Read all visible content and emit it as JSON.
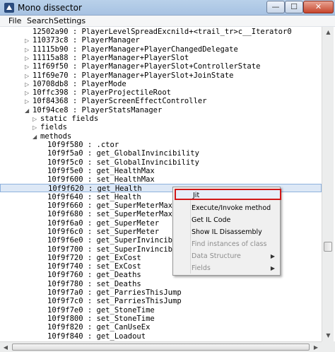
{
  "window": {
    "title": "Mono dissector",
    "minimize": "—",
    "maximize": "☐",
    "close": "✕"
  },
  "menu": {
    "file": "File",
    "search": "Search",
    "settings": "Settings"
  },
  "tree": {
    "rows": [
      {
        "text": "12502a90 : PlayerLevelSpreadExcnild+<trail_tr>c__Iterator0",
        "arrow": "",
        "indent": 0
      },
      {
        "text": "110373c8 : PlayerManager",
        "arrow": "▷",
        "indent": 0
      },
      {
        "text": "11115b90 : PlayerManager+PlayerChangedDelegate",
        "arrow": "▷",
        "indent": 0
      },
      {
        "text": "11115a88 : PlayerManager+PlayerSlot",
        "arrow": "▷",
        "indent": 0
      },
      {
        "text": "11f69f50 : PlayerManager+PlayerSlot+ControllerState",
        "arrow": "▷",
        "indent": 0
      },
      {
        "text": "11f69e70 : PlayerManager+PlayerSlot+JoinState",
        "arrow": "▷",
        "indent": 0
      },
      {
        "text": "10708db8 : PlayerMode",
        "arrow": "▷",
        "indent": 0
      },
      {
        "text": "10ffc398 : PlayerProjectileRoot",
        "arrow": "▷",
        "indent": 0
      },
      {
        "text": "10f84368 : PlayerScreenEffectController",
        "arrow": "▷",
        "indent": 0
      },
      {
        "text": "10f94ce8 : PlayerStatsManager",
        "arrow": "◢",
        "indent": 0
      },
      {
        "text": "static fields",
        "arrow": "▷",
        "indent": 1
      },
      {
        "text": "fields",
        "arrow": "▷",
        "indent": 1
      },
      {
        "text": "methods",
        "arrow": "◢",
        "indent": 1
      },
      {
        "text": "10f9f580 : .ctor",
        "arrow": "",
        "indent": 2
      },
      {
        "text": "10f9f5a0 : get_GlobalInvincibility",
        "arrow": "",
        "indent": 2
      },
      {
        "text": "10f9f5c0 : set_GlobalInvincibility",
        "arrow": "",
        "indent": 2
      },
      {
        "text": "10f9f5e0 : get_HealthMax",
        "arrow": "",
        "indent": 2
      },
      {
        "text": "10f9f600 : set_HealthMax",
        "arrow": "",
        "indent": 2
      },
      {
        "text": "10f9f620 : get_Health",
        "arrow": "",
        "indent": 2,
        "selected": true
      },
      {
        "text": "10f9f640 : set_Health",
        "arrow": "",
        "indent": 2
      },
      {
        "text": "10f9f660 : get_SuperMeterMax",
        "arrow": "",
        "indent": 2
      },
      {
        "text": "10f9f680 : set_SuperMeterMax",
        "arrow": "",
        "indent": 2
      },
      {
        "text": "10f9f6a0 : get_SuperMeter",
        "arrow": "",
        "indent": 2
      },
      {
        "text": "10f9f6c0 : set_SuperMeter",
        "arrow": "",
        "indent": 2
      },
      {
        "text": "10f9f6e0 : get_SuperInvincibl",
        "arrow": "",
        "indent": 2
      },
      {
        "text": "10f9f700 : set_SuperInvincibl",
        "arrow": "",
        "indent": 2
      },
      {
        "text": "10f9f720 : get_ExCost",
        "arrow": "",
        "indent": 2
      },
      {
        "text": "10f9f740 : set_ExCost",
        "arrow": "",
        "indent": 2
      },
      {
        "text": "10f9f760 : get_Deaths",
        "arrow": "",
        "indent": 2
      },
      {
        "text": "10f9f780 : set_Deaths",
        "arrow": "",
        "indent": 2
      },
      {
        "text": "10f9f7a0 : get_ParriesThisJump",
        "arrow": "",
        "indent": 2
      },
      {
        "text": "10f9f7c0 : set_ParriesThisJump",
        "arrow": "",
        "indent": 2
      },
      {
        "text": "10f9f7e0 : get_StoneTime",
        "arrow": "",
        "indent": 2
      },
      {
        "text": "10f9f800 : set_StoneTime",
        "arrow": "",
        "indent": 2
      },
      {
        "text": "10f9f820 : get_CanUseEx",
        "arrow": "",
        "indent": 2
      },
      {
        "text": "10f9f840 : get_Loadout",
        "arrow": "",
        "indent": 2
      }
    ]
  },
  "context_menu": {
    "items": [
      {
        "label": "Jit",
        "enabled": true,
        "highlighted": true,
        "submenu": false
      },
      {
        "label": "Execute/Invoke method",
        "enabled": true,
        "submenu": false
      },
      {
        "label": "Get IL Code",
        "enabled": true,
        "submenu": false
      },
      {
        "label": "Show IL Disassembly",
        "enabled": true,
        "submenu": false
      },
      {
        "label": "Find instances of class",
        "enabled": false,
        "submenu": false
      },
      {
        "label": "Data Structure",
        "enabled": false,
        "submenu": true
      },
      {
        "label": "Fields",
        "enabled": false,
        "submenu": true
      }
    ],
    "submenu_arrow": "▶"
  },
  "scroll": {
    "up": "▲",
    "down": "▼",
    "left": "◀",
    "right": "▶"
  },
  "colors": {
    "highlight_border": "#d11818",
    "selection_bg": "#dde8f6",
    "titlebar": "#b9d1ea"
  }
}
